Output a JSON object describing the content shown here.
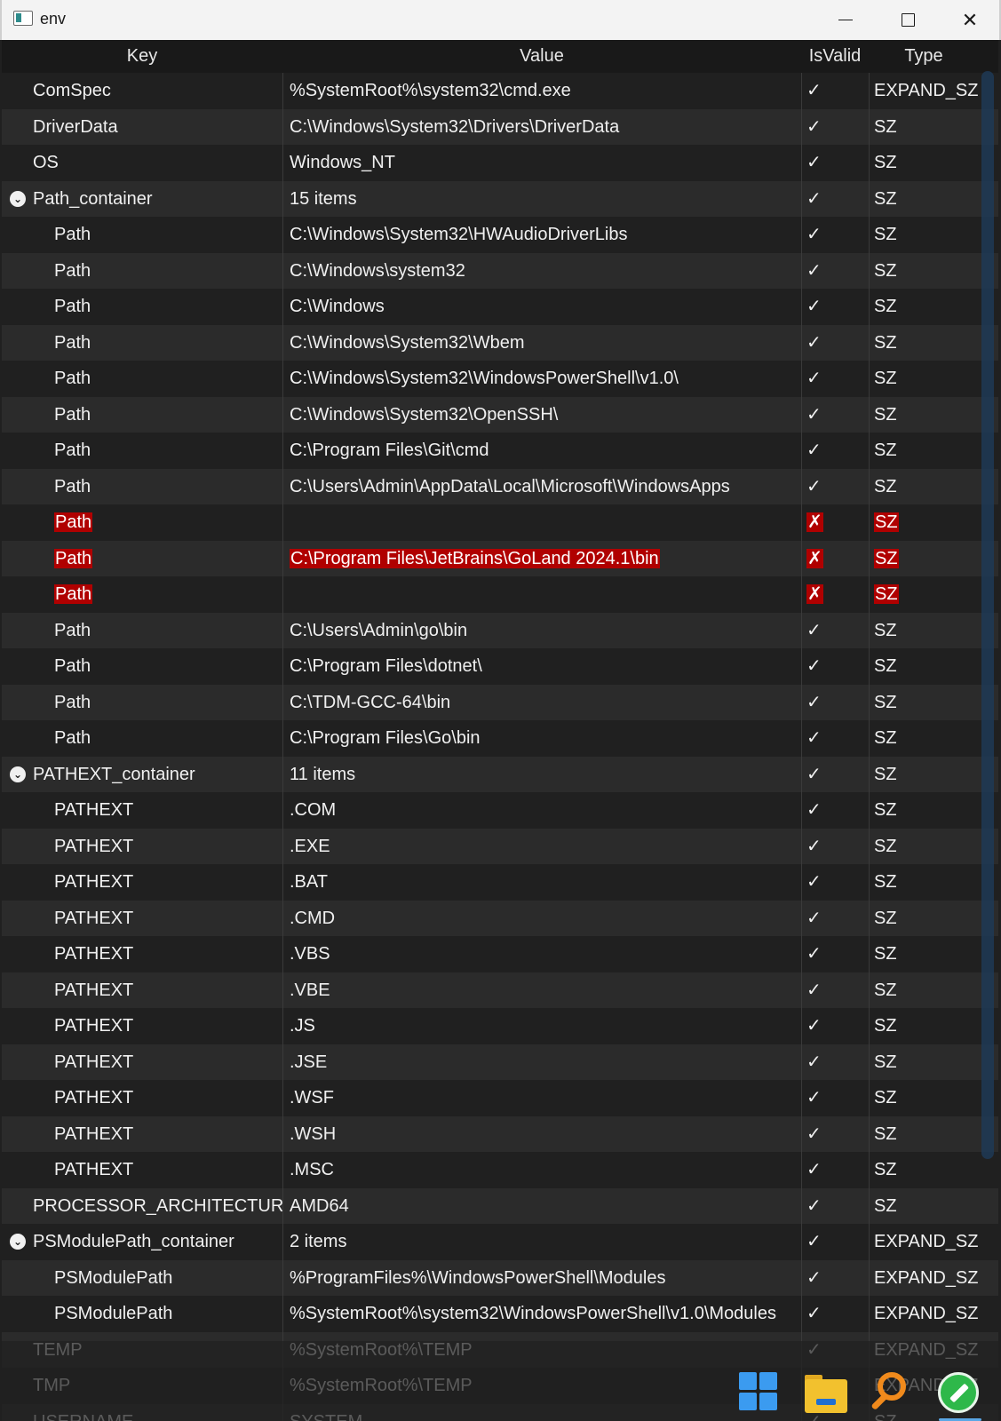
{
  "window": {
    "title": "env",
    "controls": {
      "minimize": "minimize",
      "maximize": "maximize",
      "close": "close"
    }
  },
  "columns": [
    "Key",
    "Value",
    "IsValid",
    "Type"
  ],
  "rows": [
    {
      "key": "ComSpec",
      "value": "%SystemRoot%\\system32\\cmd.exe",
      "valid": "✓",
      "type": "EXPAND_SZ",
      "level": 0
    },
    {
      "key": "DriverData",
      "value": "C:\\Windows\\System32\\Drivers\\DriverData",
      "valid": "✓",
      "type": "SZ",
      "level": 0
    },
    {
      "key": "OS",
      "value": "Windows_NT",
      "valid": "✓",
      "type": "SZ",
      "level": 0
    },
    {
      "key": "Path_container",
      "value": "15 items",
      "valid": "✓",
      "type": "SZ",
      "level": 0,
      "expanded": true
    },
    {
      "key": "Path",
      "value": "C:\\Windows\\System32\\HWAudioDriverLibs",
      "valid": "✓",
      "type": "SZ",
      "level": 1
    },
    {
      "key": "Path",
      "value": "C:\\Windows\\system32",
      "valid": "✓",
      "type": "SZ",
      "level": 1
    },
    {
      "key": "Path",
      "value": "C:\\Windows",
      "valid": "✓",
      "type": "SZ",
      "level": 1
    },
    {
      "key": "Path",
      "value": "C:\\Windows\\System32\\Wbem",
      "valid": "✓",
      "type": "SZ",
      "level": 1
    },
    {
      "key": "Path",
      "value": "C:\\Windows\\System32\\WindowsPowerShell\\v1.0\\",
      "valid": "✓",
      "type": "SZ",
      "level": 1
    },
    {
      "key": "Path",
      "value": "C:\\Windows\\System32\\OpenSSH\\",
      "valid": "✓",
      "type": "SZ",
      "level": 1
    },
    {
      "key": "Path",
      "value": "C:\\Program Files\\Git\\cmd",
      "valid": "✓",
      "type": "SZ",
      "level": 1
    },
    {
      "key": "Path",
      "value": "C:\\Users\\Admin\\AppData\\Local\\Microsoft\\WindowsApps",
      "valid": "✓",
      "type": "SZ",
      "level": 1
    },
    {
      "key": "Path",
      "value": "",
      "valid": "✗",
      "type": "SZ",
      "level": 1,
      "invalid": true
    },
    {
      "key": "Path",
      "value": "C:\\Program Files\\JetBrains\\GoLand 2024.1\\bin",
      "valid": "✗",
      "type": "SZ",
      "level": 1,
      "invalid": true
    },
    {
      "key": "Path",
      "value": "",
      "valid": "✗",
      "type": "SZ",
      "level": 1,
      "invalid": true
    },
    {
      "key": "Path",
      "value": "C:\\Users\\Admin\\go\\bin",
      "valid": "✓",
      "type": "SZ",
      "level": 1
    },
    {
      "key": "Path",
      "value": "C:\\Program Files\\dotnet\\",
      "valid": "✓",
      "type": "SZ",
      "level": 1
    },
    {
      "key": "Path",
      "value": "C:\\TDM-GCC-64\\bin",
      "valid": "✓",
      "type": "SZ",
      "level": 1
    },
    {
      "key": "Path",
      "value": "C:\\Program Files\\Go\\bin",
      "valid": "✓",
      "type": "SZ",
      "level": 1
    },
    {
      "key": "PATHEXT_container",
      "value": "11 items",
      "valid": "✓",
      "type": "SZ",
      "level": 0,
      "expanded": true
    },
    {
      "key": "PATHEXT",
      "value": ".COM",
      "valid": "✓",
      "type": "SZ",
      "level": 1
    },
    {
      "key": "PATHEXT",
      "value": ".EXE",
      "valid": "✓",
      "type": "SZ",
      "level": 1
    },
    {
      "key": "PATHEXT",
      "value": ".BAT",
      "valid": "✓",
      "type": "SZ",
      "level": 1
    },
    {
      "key": "PATHEXT",
      "value": ".CMD",
      "valid": "✓",
      "type": "SZ",
      "level": 1
    },
    {
      "key": "PATHEXT",
      "value": ".VBS",
      "valid": "✓",
      "type": "SZ",
      "level": 1
    },
    {
      "key": "PATHEXT",
      "value": ".VBE",
      "valid": "✓",
      "type": "SZ",
      "level": 1
    },
    {
      "key": "PATHEXT",
      "value": ".JS",
      "valid": "✓",
      "type": "SZ",
      "level": 1
    },
    {
      "key": "PATHEXT",
      "value": ".JSE",
      "valid": "✓",
      "type": "SZ",
      "level": 1
    },
    {
      "key": "PATHEXT",
      "value": ".WSF",
      "valid": "✓",
      "type": "SZ",
      "level": 1
    },
    {
      "key": "PATHEXT",
      "value": ".WSH",
      "valid": "✓",
      "type": "SZ",
      "level": 1
    },
    {
      "key": "PATHEXT",
      "value": ".MSC",
      "valid": "✓",
      "type": "SZ",
      "level": 1
    },
    {
      "key": "PROCESSOR_ARCHITECTURE",
      "value": "AMD64",
      "valid": "✓",
      "type": "SZ",
      "level": 0
    },
    {
      "key": "PSModulePath_container",
      "value": "2 items",
      "valid": "✓",
      "type": "EXPAND_SZ",
      "level": 0,
      "expanded": true
    },
    {
      "key": "PSModulePath",
      "value": "%ProgramFiles%\\WindowsPowerShell\\Modules",
      "valid": "✓",
      "type": "EXPAND_SZ",
      "level": 1
    },
    {
      "key": "PSModulePath",
      "value": "%SystemRoot%\\system32\\WindowsPowerShell\\v1.0\\Modules",
      "valid": "✓",
      "type": "EXPAND_SZ",
      "level": 1
    },
    {
      "key": "TEMP",
      "value": "%SystemRoot%\\TEMP",
      "valid": "✓",
      "type": "EXPAND_SZ",
      "level": 0
    },
    {
      "key": "TMP",
      "value": "%SystemRoot%\\TEMP",
      "valid": "✓",
      "type": "EXPAND_SZ",
      "level": 0
    },
    {
      "key": "USERNAME",
      "value": "SYSTEM",
      "valid": "✓",
      "type": "SZ",
      "level": 0
    }
  ],
  "taskbar": {
    "icons": [
      "windows-start-icon",
      "file-explorer-icon",
      "search-icon",
      "notepad-icon"
    ]
  },
  "colors": {
    "background": "#202020",
    "row_alt": "#2b2b2b",
    "header": "#191919",
    "invalid_highlight": "#b00000",
    "titlebar": "#f3f3f3",
    "scrollbar": "#1e3a56"
  }
}
